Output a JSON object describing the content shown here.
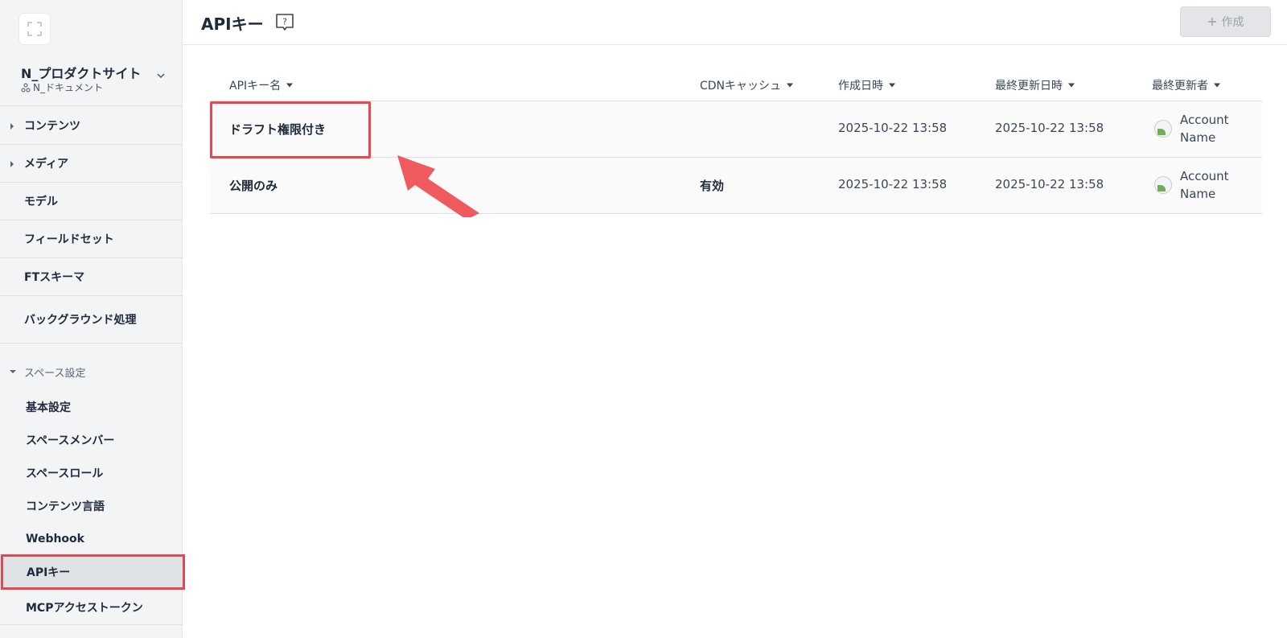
{
  "sidebar": {
    "space_name": "N_プロダクトサイト",
    "space_sub": "N_ドキュメント",
    "items": [
      {
        "label": "コンテンツ"
      },
      {
        "label": "メディア"
      },
      {
        "label": "モデル"
      },
      {
        "label": "フィールドセット"
      },
      {
        "label": "FTスキーマ"
      },
      {
        "label": "バックグラウンド処理"
      }
    ],
    "section": {
      "label": "スペース設定"
    },
    "sub_items": [
      {
        "label": "基本設定"
      },
      {
        "label": "スペースメンバー"
      },
      {
        "label": "スペースロール"
      },
      {
        "label": "コンテンツ言語"
      },
      {
        "label": "Webhook"
      },
      {
        "label": "APIキー"
      },
      {
        "label": "MCPアクセストークン"
      }
    ]
  },
  "header": {
    "title": "APIキー",
    "create_label": "作成",
    "create_icon": "plus-icon"
  },
  "table": {
    "columns": [
      "APIキー名",
      "CDNキャッシュ",
      "作成日時",
      "最終更新日時",
      "最終更新者"
    ],
    "rows": [
      {
        "name": "ドラフト権限付き",
        "cdn": "",
        "created": "2025-10-22 13:58",
        "updated": "2025-10-22 13:58",
        "updater": "Account Name"
      },
      {
        "name": "公開のみ",
        "cdn": "有効",
        "created": "2025-10-22 13:58",
        "updated": "2025-10-22 13:58",
        "updater": "Account Name"
      }
    ]
  },
  "colors": {
    "accent_red": "#e5484d",
    "sidebar_bg": "#f3f4f6",
    "text_dark": "#1f2a3c"
  }
}
